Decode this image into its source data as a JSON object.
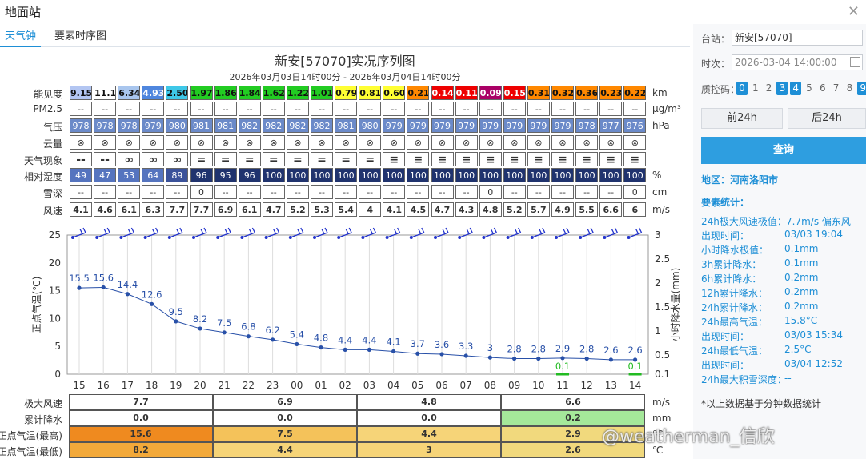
{
  "window": {
    "title": "地面站",
    "close_icon": "close-icon"
  },
  "tabs": [
    {
      "label": "天气钟",
      "active": true
    },
    {
      "label": "要素时序图",
      "active": false
    }
  ],
  "chart": {
    "title": "新安[57070]实况序列图",
    "subtitle": "2026年03月03日14时00分 - 2026年03月04日14时00分"
  },
  "table": {
    "rows": [
      {
        "key": "vis",
        "label": "能见度",
        "unit": "km",
        "values": [
          "9.15",
          "11.14",
          "6.34",
          "4.93",
          "2.50",
          "1.97",
          "1.86",
          "1.84",
          "1.62",
          "1.22",
          "1.01",
          "0.79",
          "0.81",
          "0.60",
          "0.21",
          "0.14",
          "0.11",
          "0.09",
          "0.15",
          "0.31",
          "0.32",
          "0.36",
          "0.23",
          "0.22"
        ],
        "colors": [
          "#b3c6f2",
          "#ffffff",
          "#a9c6ee",
          "#4f86de",
          "#3ec8e8",
          "#22cc22",
          "#22cc22",
          "#22cc22",
          "#22cc22",
          "#22cc22",
          "#22cc22",
          "#ffff33",
          "#ffff33",
          "#ffff33",
          "#ff8800",
          "#ee0000",
          "#ee0000",
          "#aa0066",
          "#ee0000",
          "#ff8800",
          "#ff8800",
          "#ff8800",
          "#ff8800",
          "#ff8800"
        ]
      },
      {
        "key": "pm",
        "label": "PM2.5",
        "unit": "μg/m³",
        "values": [
          "--",
          "--",
          "--",
          "--",
          "--",
          "--",
          "--",
          "--",
          "--",
          "--",
          "--",
          "--",
          "--",
          "--",
          "--",
          "--",
          "--",
          "--",
          "--",
          "--",
          "--",
          "--",
          "--",
          "--"
        ]
      },
      {
        "key": "pres",
        "label": "气压",
        "unit": "hPa",
        "values": [
          "978",
          "978",
          "978",
          "979",
          "980",
          "981",
          "981",
          "982",
          "982",
          "982",
          "982",
          "981",
          "980",
          "979",
          "979",
          "979",
          "979",
          "979",
          "979",
          "979",
          "979",
          "978",
          "977",
          "976"
        ]
      },
      {
        "key": "cloud",
        "label": "云量",
        "unit": "",
        "values": [
          "⊗",
          "⊗",
          "⊗",
          "⊗",
          "⊗",
          "⊗",
          "⊗",
          "⊗",
          "⊗",
          "⊗",
          "⊗",
          "⊗",
          "⊗",
          "⊗",
          "⊗",
          "⊗",
          "⊗",
          "⊗",
          "⊗",
          "⊗",
          "⊗",
          "⊗",
          "⊗",
          "⊗"
        ]
      },
      {
        "key": "wx",
        "label": "天气现象",
        "unit": "",
        "values": [
          "--",
          "--",
          "∞",
          "∞",
          "∞",
          "=",
          "=",
          "=",
          "=",
          "=",
          "=",
          "=",
          "=",
          "≡",
          "≡",
          "≡",
          "≡",
          "≡",
          "≡",
          "≡",
          "≡",
          "≡",
          "≡",
          "≡"
        ]
      },
      {
        "key": "rh",
        "label": "相对湿度",
        "unit": "%",
        "values": [
          "49",
          "47",
          "53",
          "64",
          "89",
          "96",
          "95",
          "96",
          "100",
          "100",
          "100",
          "100",
          "100",
          "100",
          "100",
          "100",
          "100",
          "100",
          "100",
          "100",
          "100",
          "100",
          "100",
          "100"
        ]
      },
      {
        "key": "snow",
        "label": "雪深",
        "unit": "cm",
        "values": [
          "--",
          "--",
          "--",
          "--",
          "--",
          "0",
          "--",
          "--",
          "--",
          "--",
          "--",
          "--",
          "--",
          "--",
          "--",
          "--",
          "--",
          "0",
          "--",
          "--",
          "--",
          "--",
          "--",
          "0"
        ]
      },
      {
        "key": "wind",
        "label": "风速",
        "unit": "m/s",
        "values": [
          "4.1",
          "4.6",
          "6.1",
          "6.3",
          "7.7",
          "7.7",
          "6.9",
          "6.1",
          "4.7",
          "5.2",
          "5.3",
          "5.4",
          "4",
          "4.1",
          "4.5",
          "4.7",
          "4.3",
          "4.8",
          "5.2",
          "5.7",
          "4.9",
          "5.5",
          "6.6",
          "6"
        ]
      }
    ]
  },
  "chart_data": {
    "type": "line",
    "categories": [
      "15",
      "16",
      "17",
      "18",
      "19",
      "20",
      "21",
      "22",
      "23",
      "00",
      "01",
      "02",
      "03",
      "04",
      "05",
      "06",
      "07",
      "08",
      "09",
      "10",
      "11",
      "12",
      "13",
      "14"
    ],
    "series": [
      {
        "axis": "left",
        "values": [
          15.5,
          15.6,
          14.4,
          12.6,
          9.5,
          8.2,
          7.5,
          6.8,
          6.2,
          5.4,
          4.8,
          4.4,
          4.4,
          4.1,
          3.7,
          3.6,
          3.3,
          3,
          2.8,
          2.8,
          2.9,
          2.8,
          2.6,
          2.6
        ],
        "color": "#2850a8"
      },
      {
        "axis": "right",
        "type": "bar",
        "values": [
          null,
          null,
          null,
          null,
          null,
          null,
          null,
          null,
          null,
          null,
          null,
          null,
          null,
          null,
          null,
          null,
          null,
          null,
          null,
          null,
          0.1,
          null,
          null,
          0.1
        ],
        "color": "#22bb22"
      }
    ],
    "ylabel": "正点气温(℃)",
    "y2label": "小时降水量(mm)",
    "ylim": [
      0,
      25
    ],
    "y2lim": [
      0.1,
      3
    ],
    "yticks": [
      "0",
      "5",
      "10",
      "15",
      "20",
      "25"
    ],
    "y2ticks": [
      "0.1",
      "0.5",
      "1",
      "1.5",
      "2",
      "2.5",
      "3"
    ],
    "wind_barb_icons": "wind-barb-icon"
  },
  "bottom": {
    "rows": [
      {
        "label": "极大风速",
        "unit": "m/s",
        "values": [
          "7.7",
          "6.9",
          "4.8",
          "6.6"
        ],
        "colors": [
          "#ffffff",
          "#ffffff",
          "#ffffff",
          "#ffffff"
        ]
      },
      {
        "label": "累计降水",
        "unit": "mm",
        "values": [
          "0.0",
          "0.0",
          "0.0",
          "0.2"
        ],
        "colors": [
          "#ffffff",
          "#ffffff",
          "#ffffff",
          "#a5e89a"
        ]
      },
      {
        "label": "正点气温(最高)",
        "unit": "℃",
        "values": [
          "15.6",
          "7.5",
          "4.4",
          "2.9"
        ],
        "colors": [
          "#ef8a1f",
          "#f4c25a",
          "#f6d478",
          "#f1d97d"
        ]
      },
      {
        "label": "正点气温(最低)",
        "unit": "℃",
        "values": [
          "8.2",
          "4.4",
          "3",
          "2.6"
        ],
        "colors": [
          "#f3a93a",
          "#f6d478",
          "#f6d478",
          "#f1d97d"
        ]
      }
    ]
  },
  "sidebar": {
    "station_label": "台站：",
    "station_value": "新安[57070]",
    "time_label": "时次：",
    "time_value": "2026-03-04 14:00:00",
    "qc_label": "质控码：",
    "qc_codes": [
      {
        "code": "0",
        "on": true
      },
      {
        "code": "1",
        "on": false
      },
      {
        "code": "2",
        "on": false
      },
      {
        "code": "3",
        "on": true
      },
      {
        "code": "4",
        "on": true
      },
      {
        "code": "5",
        "on": false
      },
      {
        "code": "6",
        "on": false
      },
      {
        "code": "7",
        "on": false
      },
      {
        "code": "8",
        "on": false
      },
      {
        "code": "9",
        "on": true
      }
    ],
    "prev_label": "前24h",
    "next_label": "后24h",
    "query_label": "查询",
    "region": "地区：河南洛阳市",
    "stats_title": "要素统计：",
    "stats": [
      {
        "k": "24h极大风速极值：",
        "v": "7.7m/s  偏东风"
      },
      {
        "k": "出现时间：",
        "v": "03/03 19:04"
      },
      {
        "k": "小时降水极值：",
        "v": "0.1mm"
      },
      {
        "k": "3h累计降水：",
        "v": "0.1mm"
      },
      {
        "k": "6h累计降水：",
        "v": "0.2mm"
      },
      {
        "k": "12h累计降水：",
        "v": "0.2mm"
      },
      {
        "k": "24h累计降水：",
        "v": "0.2mm"
      },
      {
        "k": "24h最高气温：",
        "v": "15.8°C"
      },
      {
        "k": "出现时间：",
        "v": "03/03 15:34"
      },
      {
        "k": "24h最低气温：",
        "v": "2.5°C"
      },
      {
        "k": "出现时间：",
        "v": "03/04 12:52"
      },
      {
        "k": "24h最大积雪深度：",
        "v": "--"
      }
    ],
    "footnote": "*以上数据基于分钟数据统计"
  },
  "watermark": "@weatherman_信欣"
}
